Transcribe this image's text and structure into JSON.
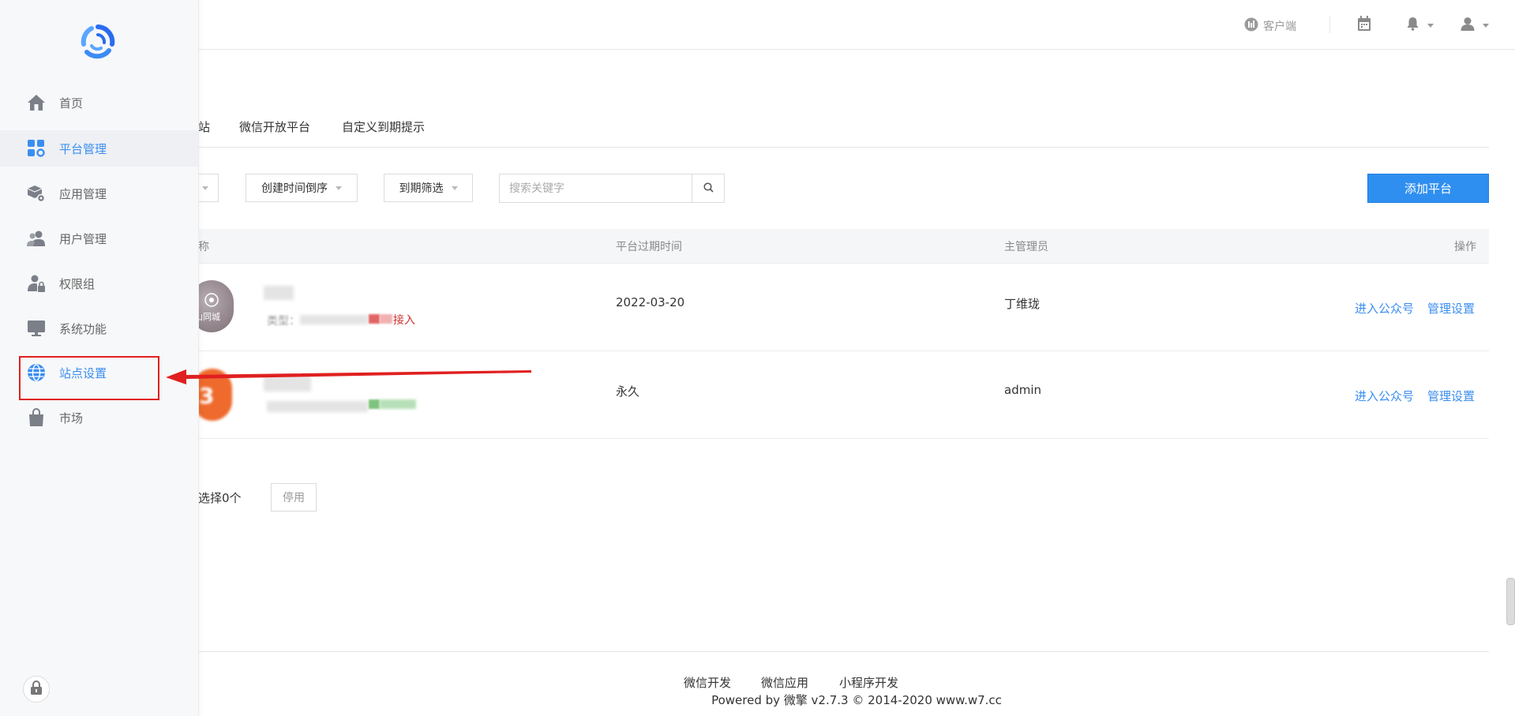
{
  "header": {
    "client_label": "客户端",
    "icons": [
      "client-icon",
      "calendar-icon",
      "bell-icon",
      "user-icon"
    ]
  },
  "sidebar": {
    "items": [
      {
        "label": "首页",
        "icon": "home-icon"
      },
      {
        "label": "平台管理",
        "icon": "grid-icon"
      },
      {
        "label": "应用管理",
        "icon": "box-gear-icon"
      },
      {
        "label": "用户管理",
        "icon": "users-icon"
      },
      {
        "label": "权限组",
        "icon": "user-lock-icon"
      },
      {
        "label": "系统功能",
        "icon": "monitor-icon"
      },
      {
        "label": "站点设置",
        "icon": "globe-icon"
      },
      {
        "label": "市场",
        "icon": "bag-icon"
      }
    ],
    "active_index": 1,
    "highlight_index": 6
  },
  "tabs": [
    "站",
    "微信开放平台",
    "自定义到期提示"
  ],
  "filters": {
    "sort": "创建时间倒序",
    "expire": "到期筛选",
    "search_placeholder": "搜索关键字",
    "add_button": "添加平台"
  },
  "table": {
    "headers": {
      "name": "称",
      "expire": "平台过期时间",
      "admin": "主管理员",
      "ops": "操作"
    },
    "rows": [
      {
        "type_suffix": "接入",
        "expire": "2022-03-20",
        "admin": "丁维珑",
        "enter": "进入公众号",
        "manage": "管理设置",
        "avatar_text": "山同城"
      },
      {
        "type_suffix": "",
        "expire": "永久",
        "admin": "admin",
        "enter": "进入公众号",
        "manage": "管理设置",
        "avatar_text": "3"
      }
    ],
    "type_prefix": "类型："
  },
  "batch": {
    "selected": "选择0个",
    "stop_button": "停用"
  },
  "footer": {
    "links": [
      "微信开发",
      "微信应用",
      "小程序开发"
    ],
    "powered": "Powered by 微擎 v2.7.3 © 2014-2020 www.w7.cc"
  },
  "colors": {
    "accent": "#2f8ff0",
    "annotation": "#e02020"
  }
}
